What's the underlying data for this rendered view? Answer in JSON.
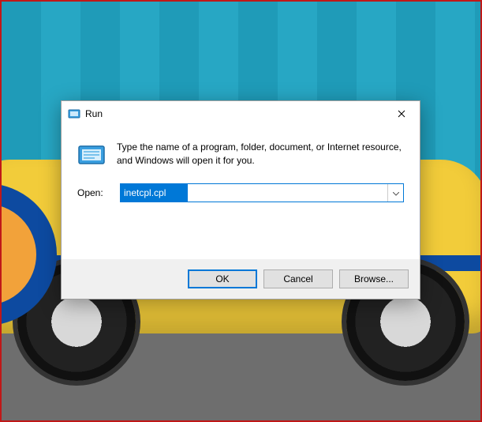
{
  "dialog": {
    "title": "Run",
    "description": "Type the name of a program, folder, document, or Internet resource, and Windows will open it for you.",
    "open_label": "Open:",
    "input_value": "inetcpl.cpl",
    "buttons": {
      "ok": "OK",
      "cancel": "Cancel",
      "browse": "Browse..."
    }
  },
  "icons": {
    "run_title": "run-icon",
    "run_big": "run-icon",
    "close": "close-icon",
    "dropdown": "chevron-down-icon"
  }
}
